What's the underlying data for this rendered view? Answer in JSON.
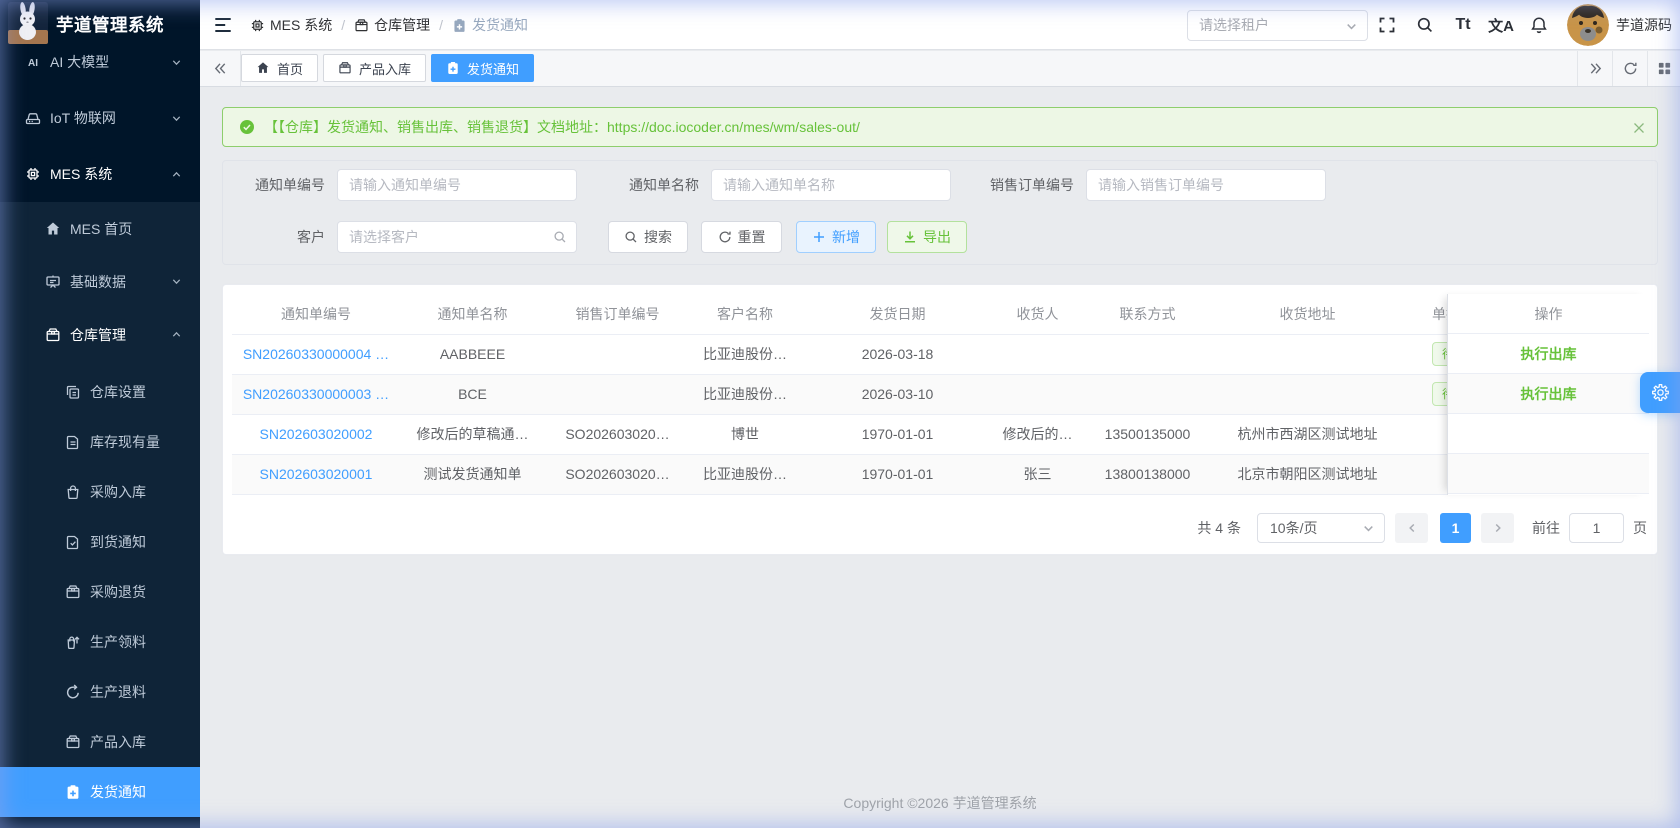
{
  "app": {
    "title": "芋道管理系统",
    "copyright": "Copyright ©2026 芋道管理系统"
  },
  "colors": {
    "primary": "#409eff",
    "success": "#67c23a",
    "sidebar_bg": "#001529",
    "sidebar_sub_bg": "#0f2438",
    "page_bg": "#e9ebee"
  },
  "sidebar": {
    "items": [
      {
        "label": "AI 大模型",
        "icon": "ai-icon",
        "level": 1,
        "expanded": false
      },
      {
        "label": "IoT 物联网",
        "icon": "iot-icon",
        "level": 1,
        "expanded": false
      },
      {
        "label": "MES 系统",
        "icon": "cpu-icon",
        "level": 1,
        "expanded": true
      },
      {
        "label": "MES 首页",
        "icon": "home-icon",
        "level": 2
      },
      {
        "label": "基础数据",
        "icon": "board-icon",
        "level": 2,
        "expanded": false
      },
      {
        "label": "仓库管理",
        "icon": "box-icon",
        "level": 2,
        "expanded": true
      },
      {
        "label": "仓库设置",
        "icon": "copy-icon",
        "level": 3
      },
      {
        "label": "库存现有量",
        "icon": "doc-icon",
        "level": 3
      },
      {
        "label": "采购入库",
        "icon": "bag-icon",
        "level": 3
      },
      {
        "label": "到货通知",
        "icon": "doc-check-icon",
        "level": 3
      },
      {
        "label": "采购退货",
        "icon": "box-icon",
        "level": 3
      },
      {
        "label": "生产领料",
        "icon": "bag-up-icon",
        "level": 3
      },
      {
        "label": "生产退料",
        "icon": "undo-icon",
        "level": 3
      },
      {
        "label": "产品入库",
        "icon": "box-icon",
        "level": 3
      },
      {
        "label": "发货通知",
        "icon": "clipboard-icon",
        "level": 3,
        "active": true
      }
    ]
  },
  "header": {
    "breadcrumb": [
      {
        "label": "MES 系统",
        "icon": "cpu-icon"
      },
      {
        "label": "仓库管理",
        "icon": "box-icon"
      },
      {
        "label": "发货通知",
        "icon": "clipboard-icon"
      }
    ],
    "tenant_placeholder": "请选择租户",
    "font_size_icon_text": "Tt",
    "lang_icon_text": "文A",
    "username": "芋道源码"
  },
  "tabs": [
    {
      "label": "首页",
      "icon": "home-icon",
      "active": false
    },
    {
      "label": "产品入库",
      "icon": "box-icon",
      "active": false
    },
    {
      "label": "发货通知",
      "icon": "clipboard-icon",
      "active": true
    }
  ],
  "alert": {
    "text": "【【仓库】发货通知、销售出库、销售退货】文档地址：",
    "link": "https://doc.iocoder.cn/mes/wm/sales-out/"
  },
  "filters": {
    "fields": [
      {
        "label": "通知单编号",
        "placeholder": "请输入通知单编号"
      },
      {
        "label": "通知单名称",
        "placeholder": "请输入通知单名称"
      },
      {
        "label": "销售订单编号",
        "placeholder": "请输入销售订单编号"
      },
      {
        "label": "客户",
        "placeholder": "请选择客户"
      }
    ],
    "buttons": {
      "search": "搜索",
      "reset": "重置",
      "add": "新增",
      "export": "导出"
    }
  },
  "table": {
    "columns": [
      "通知单编号",
      "通知单名称",
      "销售订单编号",
      "客户名称",
      "发货日期",
      "收货人",
      "联系方式",
      "收货地址",
      "单据状态",
      "操作"
    ],
    "rows": [
      {
        "code": "SN20260330000004 …",
        "name": "AABBEEE",
        "so": "",
        "customer": "比亚迪股份…",
        "date": "2026-03-18",
        "receiver": "",
        "phone": "",
        "address": "",
        "status": "待出库",
        "action": "执行出库"
      },
      {
        "code": "SN20260330000003 …",
        "name": "BCE",
        "so": "",
        "customer": "比亚迪股份…",
        "date": "2026-03-10",
        "receiver": "",
        "phone": "",
        "address": "",
        "status": "待出库",
        "action": "执行出库"
      },
      {
        "code": "SN202603020002",
        "name": "修改后的草稿通…",
        "so": "SO202603020…",
        "customer": "博世",
        "date": "1970-01-01",
        "receiver": "修改后的…",
        "phone": "13500135000",
        "address": "杭州市西湖区测试地址",
        "status": "",
        "action": ""
      },
      {
        "code": "SN202603020001",
        "name": "测试发货通知单",
        "so": "SO202603020…",
        "customer": "比亚迪股份…",
        "date": "1970-01-01",
        "receiver": "张三",
        "phone": "13800138000",
        "address": "北京市朝阳区测试地址",
        "status": "",
        "action": ""
      }
    ]
  },
  "pagination": {
    "total": "共 4 条",
    "page_size": "10条/页",
    "current": "1",
    "goto_label": "前往",
    "goto_value": "1",
    "page_suffix": "页"
  }
}
